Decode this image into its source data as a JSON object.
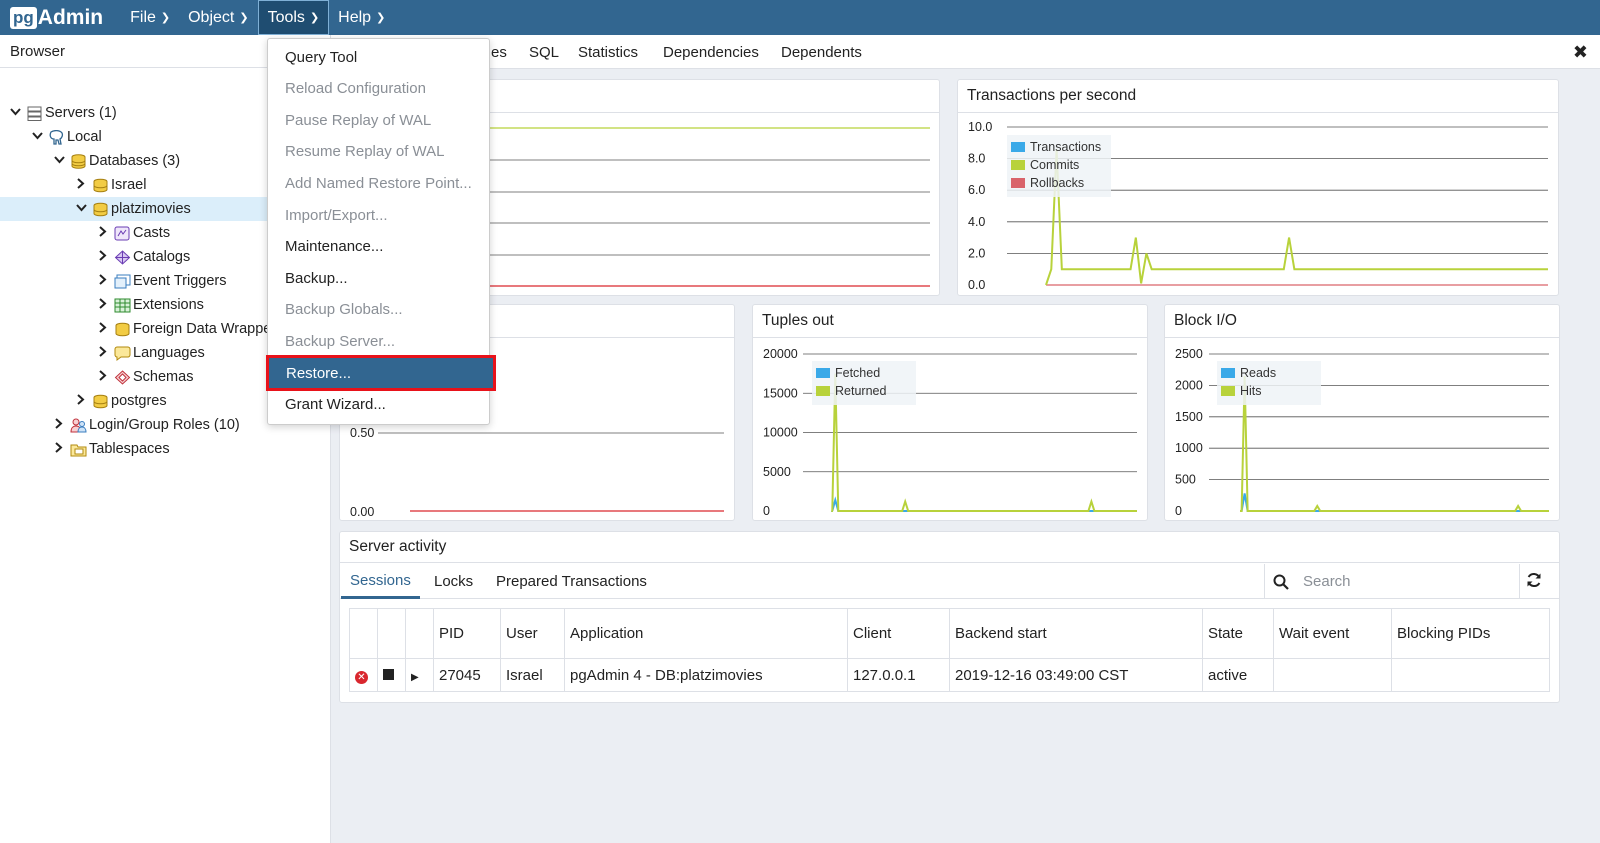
{
  "app": {
    "logo_pg": "pg",
    "logo_admin": "Admin"
  },
  "menu": [
    {
      "label": "File"
    },
    {
      "label": "Object"
    },
    {
      "label": "Tools",
      "active": true
    },
    {
      "label": "Help"
    }
  ],
  "browser": {
    "title": "Browser",
    "tree": [
      {
        "label": "Servers (1)",
        "level": 0,
        "chevron": "down",
        "icon": "servers-icon"
      },
      {
        "label": "Local",
        "level": 1,
        "chevron": "down",
        "icon": "elephant-icon"
      },
      {
        "label": "Databases (3)",
        "level": 2,
        "chevron": "down",
        "icon": "databases-icon"
      },
      {
        "label": "Israel",
        "level": 3,
        "chevron": "right",
        "icon": "database-icon"
      },
      {
        "label": "platzimovies",
        "level": 3,
        "chevron": "down",
        "icon": "database-icon",
        "selected": true
      },
      {
        "label": "Casts",
        "level": 4,
        "chevron": "right",
        "icon": "casts-icon"
      },
      {
        "label": "Catalogs",
        "level": 4,
        "chevron": "right",
        "icon": "catalogs-icon"
      },
      {
        "label": "Event Triggers",
        "level": 4,
        "chevron": "right",
        "icon": "event-triggers-icon"
      },
      {
        "label": "Extensions",
        "level": 4,
        "chevron": "right",
        "icon": "extensions-icon"
      },
      {
        "label": "Foreign Data Wrappers",
        "level": 4,
        "chevron": "right",
        "icon": "fdw-icon"
      },
      {
        "label": "Languages",
        "level": 4,
        "chevron": "right",
        "icon": "languages-icon"
      },
      {
        "label": "Schemas",
        "level": 4,
        "chevron": "right",
        "icon": "schemas-icon"
      },
      {
        "label": "postgres",
        "level": 3,
        "chevron": "right",
        "icon": "database-icon"
      },
      {
        "label": "Login/Group Roles (10)",
        "level": 2,
        "chevron": "right",
        "icon": "roles-icon"
      },
      {
        "label": "Tablespaces",
        "level": 2,
        "chevron": "right",
        "icon": "tablespaces-icon"
      }
    ]
  },
  "tabs": [
    {
      "label": "es"
    },
    {
      "label": "SQL"
    },
    {
      "label": "Statistics"
    },
    {
      "label": "Dependencies"
    },
    {
      "label": "Dependents"
    }
  ],
  "tools_menu": [
    {
      "label": "Query Tool",
      "enabled": true
    },
    {
      "label": "Reload Configuration",
      "enabled": false
    },
    {
      "label": "Pause Replay of WAL",
      "enabled": false
    },
    {
      "label": "Resume Replay of WAL",
      "enabled": false
    },
    {
      "label": "Add Named Restore Point...",
      "enabled": false
    },
    {
      "label": "Import/Export...",
      "enabled": false
    },
    {
      "label": "Maintenance...",
      "enabled": true
    },
    {
      "label": "Backup...",
      "enabled": true
    },
    {
      "label": "Backup Globals...",
      "enabled": false
    },
    {
      "label": "Backup Server...",
      "enabled": false
    },
    {
      "label": "Restore...",
      "enabled": true,
      "highlighted": true
    },
    {
      "label": "Grant Wizard...",
      "enabled": true
    }
  ],
  "chart_data": [
    {
      "type": "line",
      "title": "",
      "yticks": [],
      "series": [
        {
          "color": "#b8d23b",
          "values": [
            1,
            1,
            1,
            1,
            1,
            1,
            1,
            1,
            1,
            1
          ]
        },
        {
          "color": "#d9272e",
          "values": [
            0,
            0,
            0,
            0,
            0,
            0,
            0,
            0,
            0,
            0
          ]
        }
      ],
      "ylim": [
        0,
        1.0
      ]
    },
    {
      "type": "line",
      "title": "Transactions per second",
      "yticks": [
        "10.0",
        "8.0",
        "6.0",
        "4.0",
        "2.0",
        "0.0"
      ],
      "ylim": [
        0,
        10
      ],
      "legend": "top-left",
      "series": [
        {
          "name": "Transactions",
          "color": "#3aa9e8"
        },
        {
          "name": "Commits",
          "color": "#b8d23b"
        },
        {
          "name": "Rollbacks",
          "color": "#d9636b"
        }
      ],
      "commits": [
        0,
        1,
        8.6,
        1,
        1,
        1,
        1,
        1,
        1,
        1,
        1,
        1,
        1,
        1,
        1,
        1,
        1,
        3,
        0.1,
        2,
        1,
        1,
        1,
        1,
        1,
        1,
        1,
        1,
        1,
        1,
        1,
        1,
        1,
        1,
        1,
        1,
        1,
        1,
        1,
        1,
        1,
        1,
        1,
        1,
        1,
        1,
        3,
        1,
        1,
        1,
        1,
        1,
        1,
        1,
        1,
        1,
        1,
        1,
        1,
        1,
        1,
        1,
        1,
        1,
        1,
        1,
        1,
        1,
        1,
        1,
        1,
        1,
        1,
        1,
        1,
        1,
        1,
        1,
        1,
        1,
        1,
        1,
        1,
        1,
        1,
        1,
        1,
        1,
        1,
        1,
        1,
        1,
        1,
        1,
        1,
        1
      ]
    },
    {
      "type": "line",
      "title": "",
      "yticks": [
        "0.50",
        "0.00"
      ],
      "ylim": [
        0,
        1.0
      ]
    },
    {
      "type": "line",
      "title": "Tuples out",
      "yticks": [
        "20000",
        "15000",
        "10000",
        "5000",
        "0"
      ],
      "ylim": [
        0,
        20000
      ],
      "legend": "top-left",
      "series": [
        {
          "name": "Fetched",
          "color": "#3aa9e8"
        },
        {
          "name": "Returned",
          "color": "#b8d23b"
        }
      ],
      "returned_peaks": [
        [
          0.3,
          17500
        ],
        [
          9.5,
          1200
        ],
        [
          34,
          1200
        ]
      ],
      "fetched_peaks": [
        [
          0.3,
          1400
        ]
      ]
    },
    {
      "type": "line",
      "title": "Block I/O",
      "yticks": [
        "2500",
        "2000",
        "1500",
        "1000",
        "500",
        "0"
      ],
      "ylim": [
        0,
        2500
      ],
      "legend": "top-left",
      "series": [
        {
          "name": "Reads",
          "color": "#3aa9e8"
        },
        {
          "name": "Hits",
          "color": "#b8d23b"
        }
      ],
      "hits_peaks": [
        [
          0.6,
          2150
        ],
        [
          10,
          80
        ],
        [
          36,
          80
        ]
      ],
      "reads_peaks": [
        [
          0.6,
          280
        ]
      ]
    }
  ],
  "activity": {
    "title": "Server activity",
    "tabs": [
      {
        "label": "Sessions",
        "active": true
      },
      {
        "label": "Locks"
      },
      {
        "label": "Prepared Transactions"
      }
    ],
    "search_placeholder": "Search",
    "columns": [
      "PID",
      "User",
      "Application",
      "Client",
      "Backend start",
      "State",
      "Wait event",
      "Blocking PIDs"
    ],
    "rows": [
      {
        "pid": "27045",
        "user": "Israel",
        "application": "pgAdmin 4 - DB:platzimovies",
        "client": "127.0.0.1",
        "backend_start": "2019-12-16 03:49:00 CST",
        "state": "active",
        "wait_event": "",
        "blocking_pids": ""
      }
    ]
  },
  "colors": {
    "navbar": "#326690",
    "accent": "#326690",
    "highlight_border": "#e8121a",
    "commits": "#b8d23b",
    "transactions": "#3aa9e8",
    "rollbacks": "#d9636b"
  }
}
